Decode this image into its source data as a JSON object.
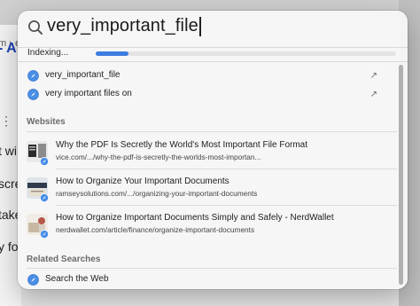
{
  "background": {
    "breadcrumb": "m › e",
    "heading": "- A",
    "dots": "⋮",
    "lines": [
      "t wi",
      "scre",
      "take",
      "y fo"
    ]
  },
  "search": {
    "query": "very_important_file"
  },
  "indexing": {
    "label": "Indexing...",
    "progress": 0.11
  },
  "suggestions": [
    {
      "text": "very_important_file",
      "arrow": "↗"
    },
    {
      "text": "very important files on",
      "arrow": "↗"
    }
  ],
  "websites": {
    "header": "Websites",
    "items": [
      {
        "title": "Why the PDF Is Secretly the World's Most Important File Format",
        "url": "vice.com/.../why-the-pdf-is-secretly-the-worlds-most-importan..."
      },
      {
        "title": "How to Organize Your Important Documents",
        "url": "ramseysolutions.com/.../organizing-your-important-documents"
      },
      {
        "title": "How to Organize Important Documents Simply and Safely - NerdWallet",
        "url": "nerdwallet.com/article/finance/organize-important-documents"
      }
    ]
  },
  "related": {
    "header": "Related Searches",
    "items": [
      {
        "text": "Search the Web"
      }
    ]
  },
  "colors": {
    "accent": "#3d7ce0",
    "link_heading": "#1a3fb0"
  }
}
